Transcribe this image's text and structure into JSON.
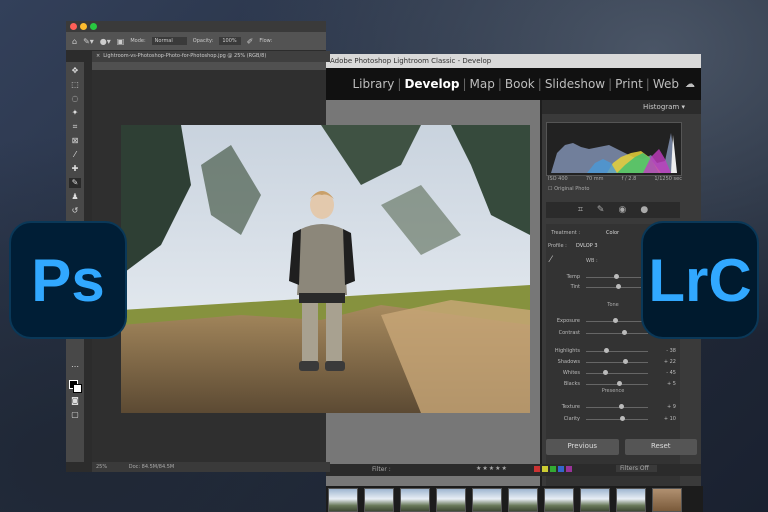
{
  "photoshop": {
    "options": {
      "mode_label": "Mode:",
      "mode_value": "Normal",
      "opacity_label": "Opacity:",
      "opacity_value": "100%",
      "flow_label": "Flow:"
    },
    "doc_tab": "Lightroom-vs-Photoshop-Photo-for-Photoshop.jpg @ 25% (RGB/8)",
    "status": {
      "zoom": "25%",
      "doc": "Doc: 84.5M/84.5M"
    }
  },
  "lightroom": {
    "window_title": "Adobe Photoshop Lightroom Classic - Develop",
    "modules": [
      "Library",
      "Develop",
      "Map",
      "Book",
      "Slideshow",
      "Print",
      "Web"
    ],
    "active_module": "Develop",
    "histogram": {
      "label": "Histogram",
      "readout": [
        "ISO 400",
        "70 mm",
        "f / 2.8",
        "1/1250 sec"
      ],
      "original_photo_label": "Original Photo"
    },
    "basic": {
      "treatment_label": "Treatment :",
      "treatment_value": "Color",
      "profile_label": "Profile :",
      "profile_value": "DVLOP 3",
      "wb_label": "WB :",
      "temp_label": "Temp",
      "tint_label": "Tint",
      "tone_label": "Tone",
      "presence_label": "Presence",
      "sliders": [
        {
          "label": "Exposure",
          "value": "",
          "level": 0.45
        },
        {
          "label": "Contrast",
          "value": "+ 20",
          "level": 0.6
        },
        {
          "label": "Highlights",
          "value": "- 38",
          "level": 0.3
        },
        {
          "label": "Shadows",
          "value": "+ 22",
          "level": 0.62
        },
        {
          "label": "Whites",
          "value": "- 45",
          "level": 0.28
        },
        {
          "label": "Blacks",
          "value": "+ 5",
          "level": 0.52
        },
        {
          "label": "Texture",
          "value": "+ 9",
          "level": 0.55
        },
        {
          "label": "Clarity",
          "value": "+ 10",
          "level": 0.56
        }
      ]
    },
    "buttons": {
      "previous": "Previous",
      "reset": "Reset"
    },
    "filter_label": "Filter :",
    "filters_off": "Filters Off"
  },
  "badges": {
    "ps": "Ps",
    "lrc": "LrC"
  }
}
